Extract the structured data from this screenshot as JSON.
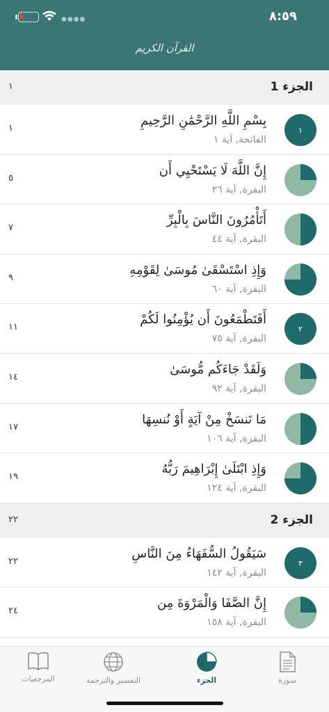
{
  "status": {
    "time": "٨:٥٩"
  },
  "header": {
    "logo_text": "القرآن الكريم"
  },
  "sections": [
    {
      "title": "الجزء 1",
      "page": "١"
    },
    {
      "title": "الجزء 2",
      "page": "٢٢"
    }
  ],
  "rows": [
    {
      "verse": "بِسْمِ اللَّهِ الرَّحْمَٰنِ الرَّحِيمِ",
      "meta": "الفاتحة, آية ١",
      "page": "١",
      "progress_label": "١"
    },
    {
      "verse": "إِنَّ اللَّهَ لَا يَسْتَحْيِي أَن",
      "meta": "البقرة, آية ٢٦",
      "page": "٥",
      "progress_fraction": 0.25
    },
    {
      "verse": "أَتَأْمُرُونَ النَّاسَ بِالْبِرِّ",
      "meta": "البقرة, آية ٤٤",
      "page": "٧",
      "progress_fraction": 0.5
    },
    {
      "verse": "وَإِذِ اسْتَسْقَىٰ مُوسَىٰ لِقَوْمِهِ",
      "meta": "البقرة, آية ٦٠",
      "page": "٩",
      "progress_fraction": 0.75
    },
    {
      "verse": "أَفَتَطْمَعُونَ أَن يُؤْمِنُوا لَكُمْ",
      "meta": "البقرة, آية ٧٥",
      "page": "١١",
      "progress_label": "٢"
    },
    {
      "verse": "وَلَقَدْ جَاءَكُم مُّوسَىٰ",
      "meta": "البقرة, آية ٩٢",
      "page": "١٤",
      "progress_fraction": 0.25
    },
    {
      "verse": "مَا نَنسَخْ مِنْ آيَةٍ أَوْ نُنسِهَا",
      "meta": "البقرة, آية ١٠٦",
      "page": "١٧",
      "progress_fraction": 0.5
    },
    {
      "verse": "وَإِذِ ابْتَلَىٰ إِبْرَاهِيمَ رَبُّهُ",
      "meta": "البقرة, آية ١٢٤",
      "page": "١٩",
      "progress_fraction": 0.75
    },
    {
      "verse": "سَيَقُولُ السُّفَهَاءُ مِنَ النَّاسِ",
      "meta": "البقرة, آية ١٤٢",
      "page": "٢٢",
      "progress_label": "٣"
    },
    {
      "verse": "إِنَّ الصَّفَا وَالْمَرْوَةَ مِن",
      "meta": "البقرة, آية ١٥٨",
      "page": "٢٤",
      "progress_fraction": 0.25
    }
  ],
  "tabs": [
    {
      "label": "سورة",
      "icon": "document-icon",
      "active": false
    },
    {
      "label": "الجزء",
      "icon": "pie-icon",
      "active": true
    },
    {
      "label": "التفسير والترجمة",
      "icon": "globe-icon",
      "active": false
    },
    {
      "label": "المرجعيات",
      "icon": "book-icon",
      "active": false
    }
  ],
  "colors": {
    "accent": "#1f6b6b",
    "accent_light": "#8fb9a4",
    "header": "#3a7676"
  }
}
